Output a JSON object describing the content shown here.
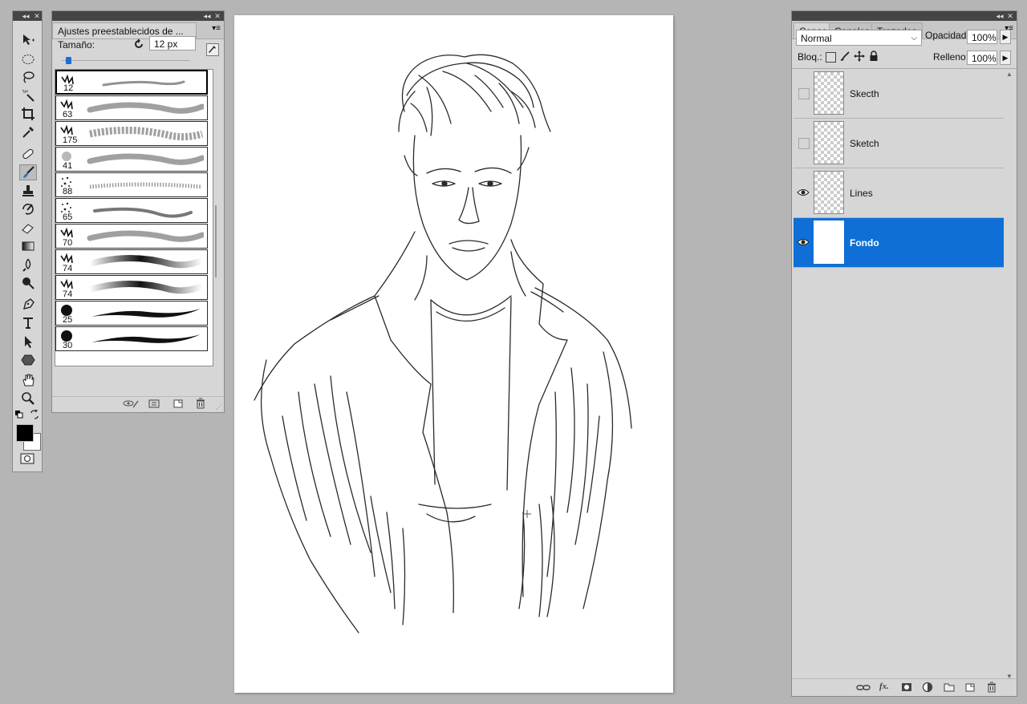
{
  "toolbox": {
    "collapse_label": "◂◂",
    "close_label": "✕"
  },
  "brush_panel": {
    "title": "Ajustes preestablecidos de ...",
    "size_label": "Tamaño:",
    "size_value": "12 px",
    "size_slider_fraction": 0.05,
    "brushes": [
      {
        "size": "12"
      },
      {
        "size": "63"
      },
      {
        "size": "175"
      },
      {
        "size": "41"
      },
      {
        "size": "88"
      },
      {
        "size": "65"
      },
      {
        "size": "70"
      },
      {
        "size": "74"
      },
      {
        "size": "74"
      },
      {
        "size": "25"
      },
      {
        "size": "30"
      }
    ]
  },
  "layers_panel": {
    "tabs": [
      "Capas",
      "Canales",
      "Trazados"
    ],
    "blend_mode": "Normal",
    "opacity_label": "Opacidad:",
    "opacity_value": "100%",
    "lock_label": "Bloq.:",
    "fill_label": "Relleno:",
    "fill_value": "100%",
    "layers": [
      {
        "name": "Skecth",
        "visible": false,
        "selected": false
      },
      {
        "name": "Sketch",
        "visible": false,
        "selected": false
      },
      {
        "name": "Lines",
        "visible": true,
        "selected": false
      },
      {
        "name": "Fondo",
        "visible": true,
        "selected": true
      }
    ]
  },
  "colors": {
    "accent": "#0f6fd6",
    "workspace": "#b5b5b5",
    "panel": "#d6d6d6"
  }
}
